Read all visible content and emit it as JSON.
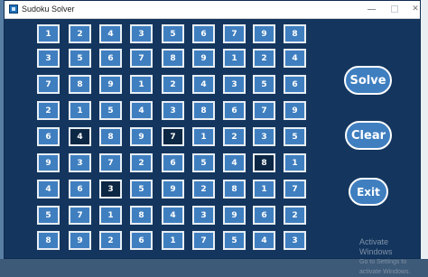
{
  "window": {
    "title": "Sudoku Solver"
  },
  "grid": {
    "rows": [
      [
        "1",
        "2",
        "4",
        "3",
        "5",
        "6",
        "7",
        "9",
        "8"
      ],
      [
        "3",
        "5",
        "6",
        "7",
        "8",
        "9",
        "1",
        "2",
        "4"
      ],
      [
        "7",
        "8",
        "9",
        "1",
        "2",
        "4",
        "3",
        "5",
        "6"
      ],
      [
        "2",
        "1",
        "5",
        "4",
        "3",
        "8",
        "6",
        "7",
        "9"
      ],
      [
        "6",
        "4",
        "8",
        "9",
        "7",
        "1",
        "2",
        "3",
        "5"
      ],
      [
        "9",
        "3",
        "7",
        "2",
        "6",
        "5",
        "4",
        "8",
        "1"
      ],
      [
        "4",
        "6",
        "3",
        "5",
        "9",
        "2",
        "8",
        "1",
        "7"
      ],
      [
        "5",
        "7",
        "1",
        "8",
        "4",
        "3",
        "9",
        "6",
        "2"
      ],
      [
        "8",
        "9",
        "2",
        "6",
        "1",
        "7",
        "5",
        "4",
        "3"
      ]
    ],
    "highlighted_cells": [
      [
        4,
        1
      ],
      [
        4,
        4
      ],
      [
        5,
        7
      ],
      [
        6,
        2
      ]
    ]
  },
  "buttons": {
    "solve": "Solve",
    "clear": "Clear",
    "exit": "Exit"
  },
  "watermark": {
    "title": "Activate Windows",
    "subtitle": "Go to Settings to activate Windows."
  },
  "colors": {
    "window_background": "#14365e",
    "cell_fill": "#3f7fc0",
    "cell_highlight": "#0c2744",
    "cell_border": "#e8eef4"
  }
}
